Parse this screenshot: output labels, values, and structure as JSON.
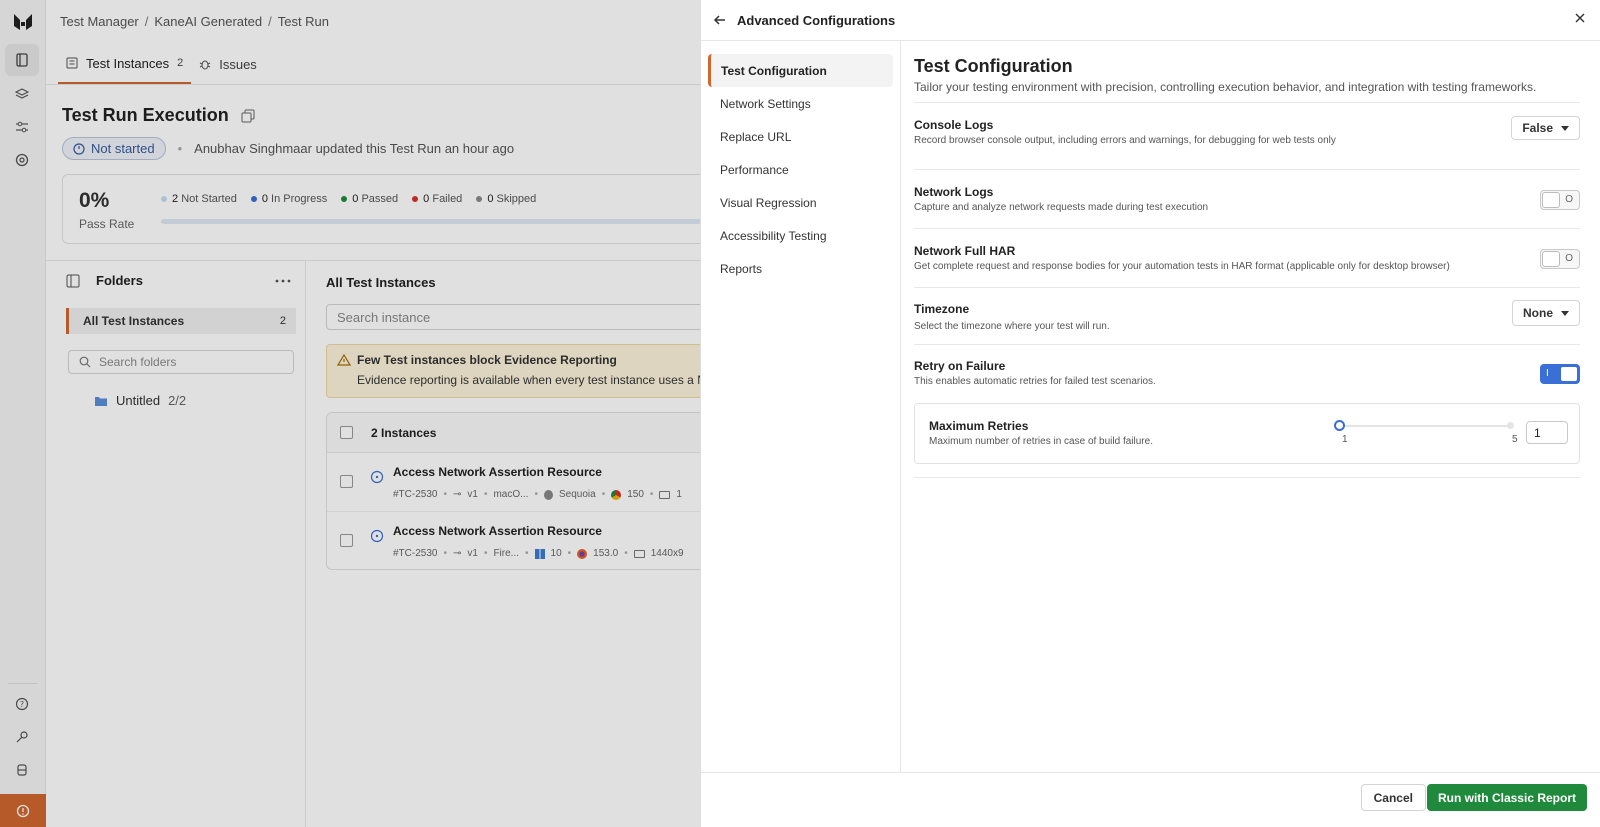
{
  "colors": {
    "accent": "#d0672f",
    "primary_blue": "#3a6fd8",
    "success_green": "#1f8a3b"
  },
  "breadcrumb": {
    "items": [
      "Test Manager",
      "KaneAI Generated",
      "Test Run"
    ]
  },
  "tabs": [
    {
      "label": "Test Instances",
      "count": "2",
      "icon": "list-icon"
    },
    {
      "label": "Issues",
      "icon": "bug-icon"
    }
  ],
  "page": {
    "title": "Test Run Execution"
  },
  "status": {
    "badge": "Not started",
    "activity": "Anubhav Singhmaar updated this Test Run an hour ago"
  },
  "stats": {
    "pass_rate": "0%",
    "pass_rate_label": "Pass Rate",
    "legend": [
      {
        "count": "2",
        "label": "Not Started",
        "color": "#c7dcef"
      },
      {
        "count": "0",
        "label": "In Progress",
        "color": "#3a6fd8"
      },
      {
        "count": "0",
        "label": "Passed",
        "color": "#1f8a3b"
      },
      {
        "count": "0",
        "label": "Failed",
        "color": "#d93025"
      },
      {
        "count": "0",
        "label": "Skipped",
        "color": "#8a8a8a"
      }
    ]
  },
  "folders": {
    "title": "Folders",
    "all_label": "All Test Instances",
    "all_count": "2",
    "search_placeholder": "Search folders",
    "items": [
      {
        "name": "Untitled",
        "count": "2/2"
      }
    ]
  },
  "instances": {
    "title": "All Test Instances",
    "search_placeholder": "Search instance",
    "warning_title": "Few Test instances block Evidence Reporting",
    "warning_text": "Evidence reporting is available when every test instance uses a N",
    "count_label": "2 Instances",
    "rows": [
      {
        "name": "Access Network Assertion Resource",
        "id": "#TC-2530",
        "version": "v1",
        "os": "macO...",
        "os_version": "Sequoia",
        "browser_version": "150",
        "resolution": "1"
      },
      {
        "name": "Access Network Assertion Resource",
        "id": "#TC-2530",
        "version": "v1",
        "os": "Fire...",
        "os_version": "10",
        "browser_version": "153.0",
        "resolution": "1440x9"
      }
    ]
  },
  "drawer": {
    "title": "Advanced Configurations",
    "nav": [
      "Test Configuration",
      "Network Settings",
      "Replace URL",
      "Performance",
      "Visual Regression",
      "Accessibility Testing",
      "Reports"
    ],
    "section_title": "Test Configuration",
    "section_desc": "Tailor your testing environment with precision, controlling execution behavior, and integration with testing frameworks.",
    "options": {
      "console_logs": {
        "title": "Console Logs",
        "desc": "Record browser console output, including errors and warnings, for debugging for web tests only",
        "value": "False"
      },
      "network_logs": {
        "title": "Network Logs",
        "desc": "Capture and analyze network requests made during test execution",
        "enabled": false,
        "off_glyph": "O"
      },
      "network_har": {
        "title": "Network Full HAR",
        "desc": "Get complete request and response bodies for your automation tests in HAR format (applicable only for desktop browser)",
        "enabled": false,
        "off_glyph": "O"
      },
      "timezone": {
        "title": "Timezone",
        "desc": "Select the timezone where your test will run.",
        "value": "None"
      },
      "retry": {
        "title": "Retry on Failure",
        "desc": "This enables automatic retries for failed test scenarios.",
        "enabled": true,
        "on_glyph": "I"
      },
      "max_retries": {
        "title": "Maximum Retries",
        "desc": "Maximum number of retries in case of build failure.",
        "min": "1",
        "max": "5",
        "value": "1"
      }
    },
    "footer": {
      "cancel": "Cancel",
      "run": "Run with Classic Report"
    }
  }
}
